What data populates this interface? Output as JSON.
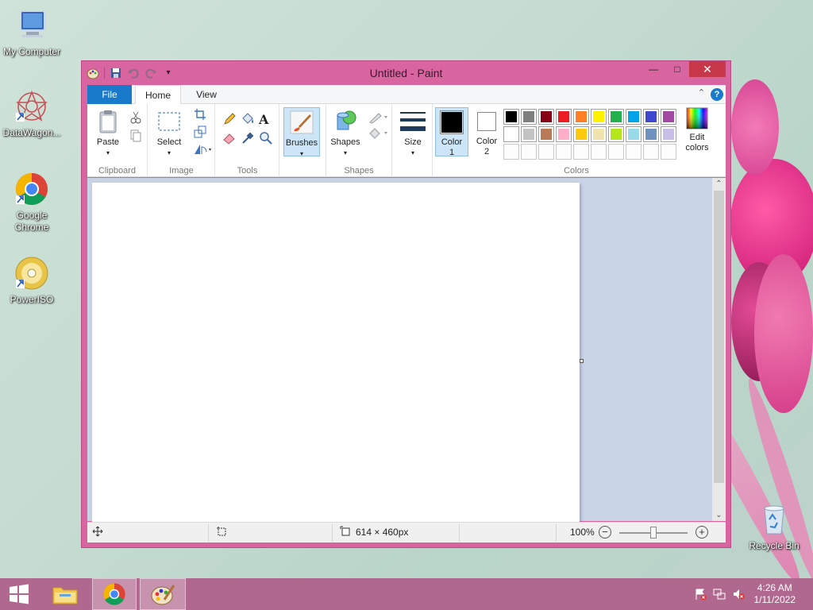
{
  "desktop": {
    "icons": [
      {
        "label": "My Computer",
        "icon": "computer-icon"
      },
      {
        "label": "DataWagon...",
        "icon": "datawagon-icon"
      },
      {
        "label": "Google Chrome",
        "icon": "chrome-icon"
      },
      {
        "label": "PowerISO",
        "icon": "poweriso-icon"
      },
      {
        "label": "Recycle Bin",
        "icon": "recycle-bin-icon"
      }
    ]
  },
  "window": {
    "title": "Untitled - Paint",
    "controls": {
      "minimize": "—",
      "maximize": "□",
      "close": "✕"
    }
  },
  "ribbon": {
    "tabs": [
      {
        "label": "File"
      },
      {
        "label": "Home"
      },
      {
        "label": "View"
      }
    ],
    "help": "?",
    "groups": {
      "clipboard": {
        "label": "Clipboard",
        "paste": "Paste"
      },
      "image": {
        "label": "Image",
        "select": "Select"
      },
      "tools": {
        "label": "Tools",
        "text": "A"
      },
      "brushes": {
        "label": "Brushes"
      },
      "shapes": {
        "label": "Shapes",
        "button": "Shapes"
      },
      "size": {
        "label": "Size"
      },
      "colors": {
        "label": "Colors",
        "color1": "Color 1",
        "color1_line1": "Color",
        "color1_line2": "1",
        "color2_line1": "Color",
        "color2_line2": "2",
        "edit_line1": "Edit",
        "edit_line2": "colors",
        "color1_value": "#000000",
        "color2_value": "#ffffff",
        "palette_row1": [
          "#000000",
          "#7f7f7f",
          "#880015",
          "#ed1c24",
          "#ff7f27",
          "#fff200",
          "#22b14c",
          "#00a2e8",
          "#3f48cc",
          "#a349a4"
        ],
        "palette_row2": [
          "#ffffff",
          "#c3c3c3",
          "#b97a57",
          "#ffaec9",
          "#ffc90e",
          "#efe4b0",
          "#b5e61d",
          "#99d9ea",
          "#7092be",
          "#c8bfe7"
        ],
        "palette_row3": [
          "#ffffff",
          "#ffffff",
          "#ffffff",
          "#ffffff",
          "#ffffff",
          "#ffffff",
          "#ffffff",
          "#ffffff",
          "#ffffff",
          "#ffffff"
        ]
      }
    }
  },
  "status": {
    "canvas_size": "614 × 460px",
    "zoom": "100%",
    "zoom_out": "−",
    "zoom_in": "+"
  },
  "taskbar": {
    "time": "4:26 AM",
    "date": "1/11/2022"
  },
  "colors": {
    "window_frame": "#d864a0",
    "file_tab": "#1979ca",
    "close_button": "#c7394a",
    "taskbar": "#b0688f"
  }
}
